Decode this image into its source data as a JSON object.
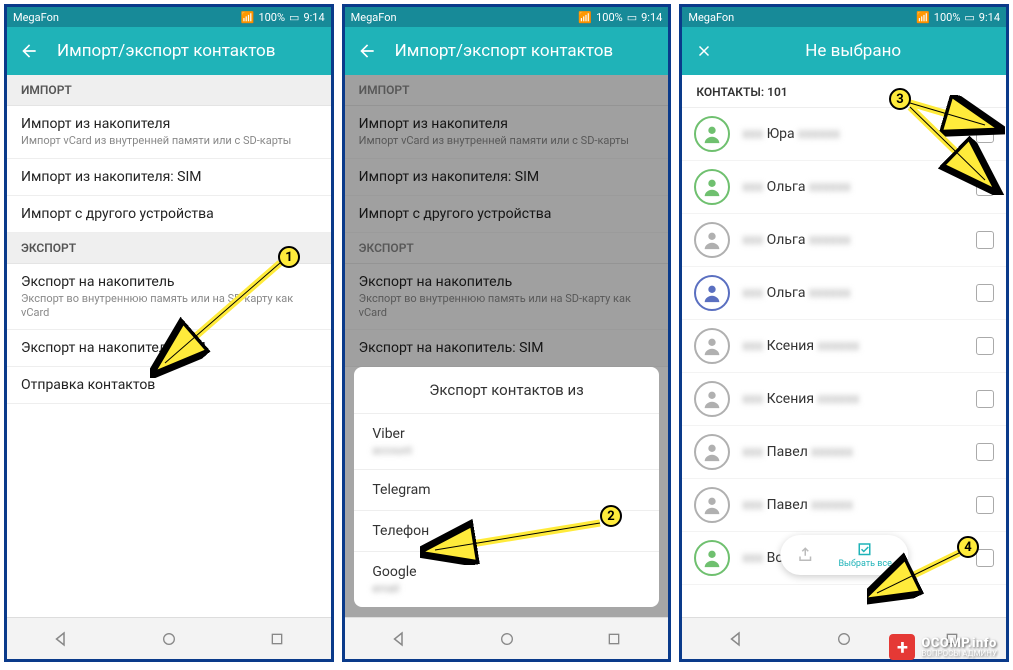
{
  "status": {
    "carrier": "MegaFon",
    "battery": "100%",
    "time": "9:14"
  },
  "screen1": {
    "title": "Импорт/экспорт контактов",
    "sections": {
      "import": {
        "header": "ИМПОРТ",
        "items": [
          {
            "primary": "Импорт из накопителя",
            "secondary": "Импорт vCard из внутренней памяти или с SD-карты"
          },
          {
            "primary": "Импорт из накопителя: SIM"
          },
          {
            "primary": "Импорт с другого устройства"
          }
        ]
      },
      "export": {
        "header": "ЭКСПОРТ",
        "items": [
          {
            "primary": "Экспорт на накопитель",
            "secondary": "Экспорт во внутреннюю память или на SD-карту как vCard"
          },
          {
            "primary": "Экспорт на накопитель: SIM"
          },
          {
            "primary": "Отправка контактов"
          }
        ]
      }
    }
  },
  "screen2": {
    "title": "Импорт/экспорт контактов",
    "dialog": {
      "title": "Экспорт контактов из",
      "options": [
        {
          "label": "Viber",
          "sub": " "
        },
        {
          "label": "Telegram"
        },
        {
          "label": "Телефон"
        },
        {
          "label": "Google",
          "sub": " "
        }
      ]
    }
  },
  "screen3": {
    "title": "Не выбрано",
    "contacts_count_label": "КОНТАКТЫ: 101",
    "contacts": [
      {
        "name": "Юра",
        "color": "#6fc06f"
      },
      {
        "name": "Ольга",
        "color": "#6fc06f"
      },
      {
        "name": "Ольга",
        "color": "#b0b0b0"
      },
      {
        "name": "Ольга",
        "color": "#5a6fc0"
      },
      {
        "name": "Ксения",
        "color": "#b0b0b0"
      },
      {
        "name": "Ксения",
        "color": "#b0b0b0"
      },
      {
        "name": "Павел",
        "color": "#b0b0b0"
      },
      {
        "name": "Павел",
        "color": "#b0b0b0"
      },
      {
        "name": "Володя",
        "color": "#6fc06f"
      }
    ],
    "toolbar": {
      "select_all": "Выбрать все"
    }
  },
  "markers": {
    "1": "1",
    "2": "2",
    "3": "3",
    "4": "4"
  },
  "watermark": {
    "line1": "OCOMP.info",
    "line2": "ВОПРОСЫ АДМИНУ"
  }
}
